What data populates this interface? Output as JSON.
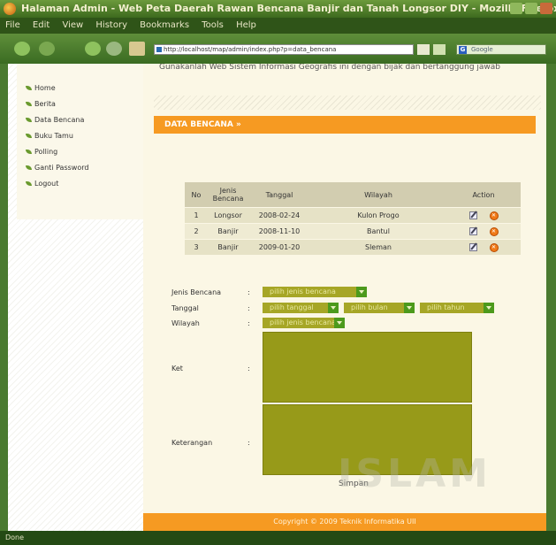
{
  "window": {
    "title": "Halaman Admin - Web Peta Daerah Rawan Bencana Banjir dan Tanah Longsor DIY - Mozilla Firefox"
  },
  "menubar": {
    "items": [
      "File",
      "Edit",
      "View",
      "History",
      "Bookmarks",
      "Tools",
      "Help"
    ]
  },
  "navbar": {
    "url": "http://localhost/map/admin/index.php?p=data_bencana",
    "search_placeholder": "Google"
  },
  "sidebar": {
    "items": [
      "Home",
      "Berita",
      "Data Bencana",
      "Buku Tamu",
      "Polling",
      "Ganti Password",
      "Logout"
    ]
  },
  "content": {
    "intro": "Gunakanlah Web Sistem Informasi Geografis ini dengan bijak dan bertanggung jawab",
    "section_title": "DATA BENCANA »",
    "table": {
      "headers": [
        "No",
        "Jenis Bencana",
        "Tanggal",
        "Wilayah",
        "Action"
      ],
      "rows": [
        {
          "no": "1",
          "jenis": "Longsor",
          "tanggal": "2008-02-24",
          "wilayah": "Kulon Progo"
        },
        {
          "no": "2",
          "jenis": "Banjir",
          "tanggal": "2008-11-10",
          "wilayah": "Bantul"
        },
        {
          "no": "3",
          "jenis": "Banjir",
          "tanggal": "2009-01-20",
          "wilayah": "Sleman"
        }
      ]
    },
    "form": {
      "jenis_label": "Jenis Bencana",
      "tanggal_label": "Tanggal",
      "wilayah_label": "Wilayah",
      "ket_label": "Ket",
      "keterangan_label": "Keterangan",
      "colon": ":",
      "jenis_value": "pilih jenis bencana",
      "tanggal_value": "pilih tanggal",
      "bulan_value": "pilih bulan",
      "tahun_value": "pilih tahun",
      "wilayah_value": "pilih jenis bencana",
      "submit_label": "Simpan"
    },
    "watermark": "ISLAM",
    "footer": "Copyright © 2009 Teknik Informatika UII"
  },
  "status": {
    "text": "Done"
  }
}
